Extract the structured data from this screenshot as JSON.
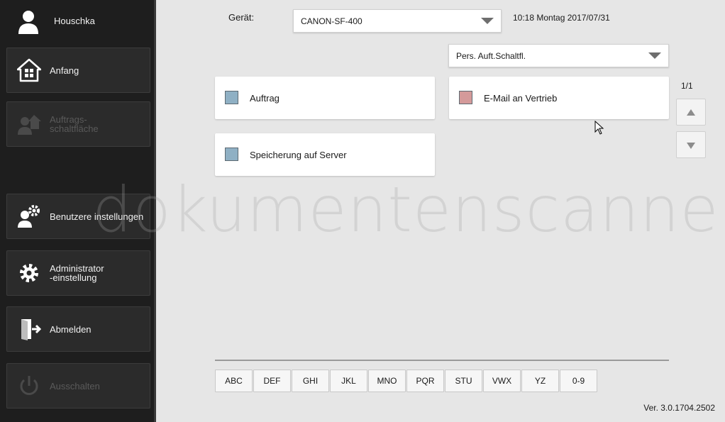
{
  "user": {
    "name": "Houschka"
  },
  "sidebar": {
    "items": [
      {
        "label": "Anfang",
        "icon": "home-icon",
        "enabled": true
      },
      {
        "label": "Auftrags-\nschaltfläche",
        "icon": "user-home-icon",
        "enabled": false
      },
      {
        "label": "Benutzere instellungen",
        "icon": "user-settings-icon",
        "enabled": true
      },
      {
        "label": "Administrator\n-einstellung",
        "icon": "gear-icon",
        "enabled": true
      },
      {
        "label": "Abmelden",
        "icon": "logout-icon",
        "enabled": true
      },
      {
        "label": "Ausschalten",
        "icon": "power-icon",
        "enabled": false
      }
    ]
  },
  "header": {
    "device_label": "Gerät:",
    "device_value": "CANON-SF-400",
    "datetime": "10:18 Montag 2017/07/31"
  },
  "filter": {
    "value": "Pers. Auft.Schaltfl."
  },
  "jobs": [
    {
      "label": "Auftrag",
      "color": "#8fb0c4"
    },
    {
      "label": "E-Mail an Vertrieb",
      "color": "#d49a9a"
    },
    {
      "label": "Speicherung auf Server",
      "color": "#8fb0c4"
    }
  ],
  "pager": {
    "text": "1/1"
  },
  "alpha_index": [
    "ABC",
    "DEF",
    "GHI",
    "JKL",
    "MNO",
    "PQR",
    "STU",
    "VWX",
    "YZ",
    "0-9"
  ],
  "version": "Ver. 3.0.1704.2502",
  "watermark": "dokumentenscanner",
  "colors": {
    "sidebar": "#1e1e1e",
    "background": "#e6e6e6"
  }
}
